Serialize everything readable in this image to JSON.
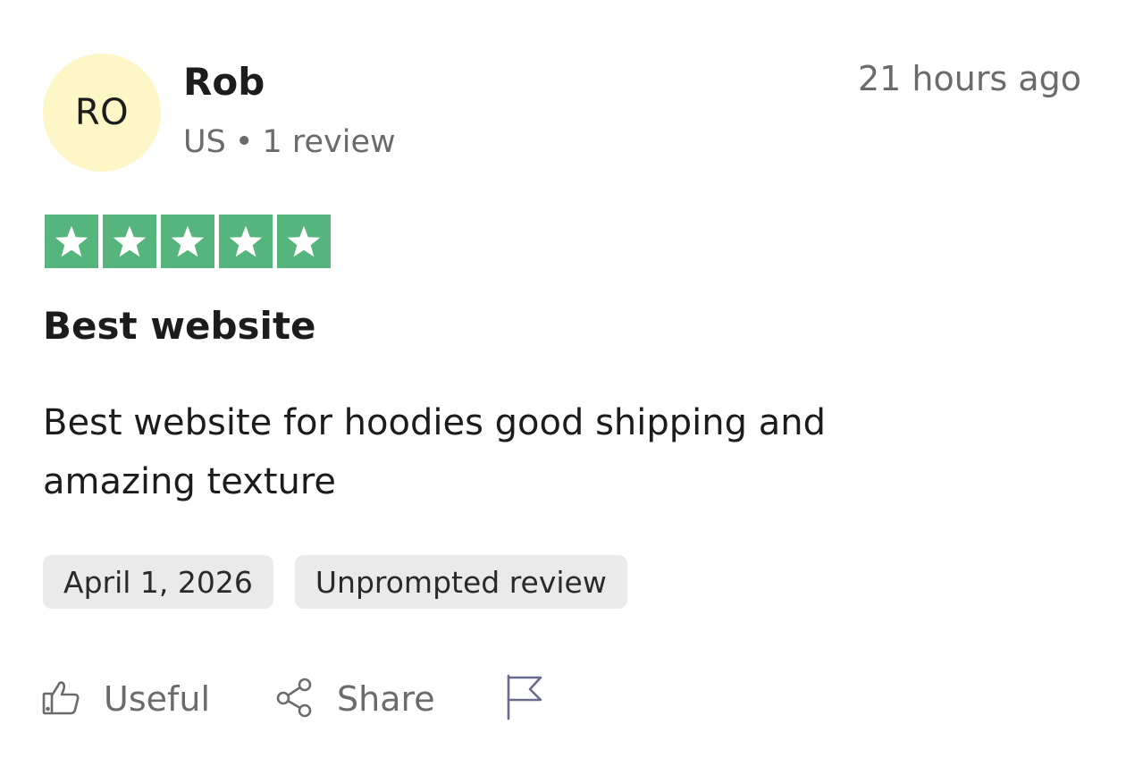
{
  "reviewer": {
    "initials": "RO",
    "name": "Rob",
    "country": "US",
    "separator": "•",
    "review_count": "1 review",
    "avatar_color": "#fdf6c6"
  },
  "posted_ago": "21 hours ago",
  "rating": {
    "value": 5,
    "max": 5,
    "color": "#56b57c"
  },
  "review": {
    "title": "Best website",
    "body": "Best website for hoodies good shipping and amazing texture"
  },
  "tags": [
    "April 1, 2026",
    "Unprompted review"
  ],
  "actions": {
    "useful_label": "Useful",
    "share_label": "Share",
    "useful_icon": "thumbs-up-icon",
    "share_icon": "share-icon",
    "report_icon": "flag-icon"
  }
}
